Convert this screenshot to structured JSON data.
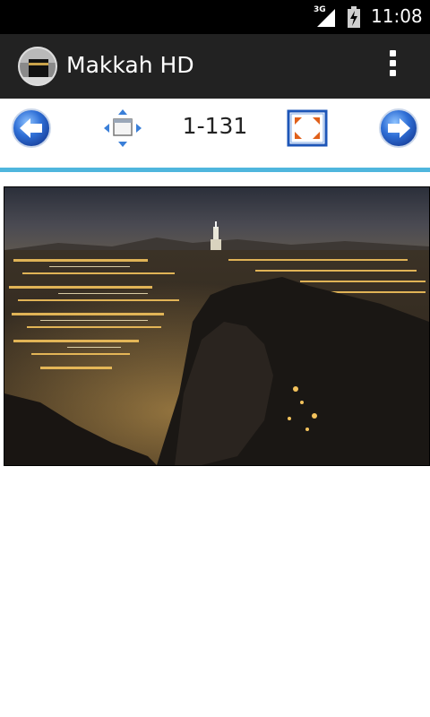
{
  "status": {
    "network": "3G",
    "time": "11:08"
  },
  "app": {
    "title": "Makkah HD"
  },
  "toolbar": {
    "counter": "1-131"
  },
  "icons": {
    "status_signal": "signal-icon",
    "status_battery": "battery-charging-icon",
    "app": "kaaba-app-icon",
    "overflow": "overflow-menu-icon",
    "prev": "arrow-left-icon",
    "fit": "fit-screen-icon",
    "fullscreen": "fullscreen-icon",
    "next": "arrow-right-icon"
  },
  "colors": {
    "actionbar": "#222222",
    "divider": "#4fb6dd",
    "arrow_blue": "#2f6fd6"
  }
}
